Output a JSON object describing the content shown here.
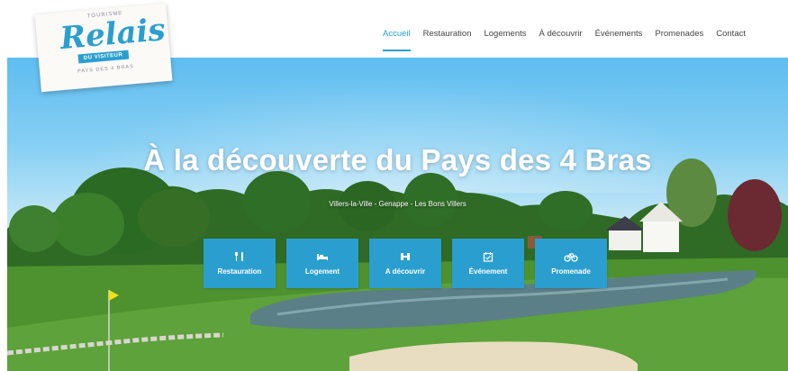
{
  "logo": {
    "top_text": "TOURISME",
    "main": "Relais",
    "ribbon": "DU VISITEUR",
    "bottom_text": "PAYS DES 4 BRAS"
  },
  "nav": {
    "items": [
      {
        "label": "Accueil",
        "active": true
      },
      {
        "label": "Restauration"
      },
      {
        "label": "Logements"
      },
      {
        "label": "À découvrir"
      },
      {
        "label": "Événements"
      },
      {
        "label": "Promenades"
      },
      {
        "label": "Contact"
      }
    ]
  },
  "hero": {
    "title": "À la découverte du Pays des 4 Bras",
    "subtitle": "Villers-la-Ville - Genappe - Les Bons Villers"
  },
  "tiles": [
    {
      "label": "Restauration",
      "icon": "fork-knife-icon"
    },
    {
      "label": "Logement",
      "icon": "bed-icon"
    },
    {
      "label": "A découvrir",
      "icon": "binoculars-icon"
    },
    {
      "label": "Événement",
      "icon": "calendar-icon"
    },
    {
      "label": "Promenade",
      "icon": "bicycle-icon"
    }
  ],
  "colors": {
    "accent": "#2a9fcf"
  }
}
